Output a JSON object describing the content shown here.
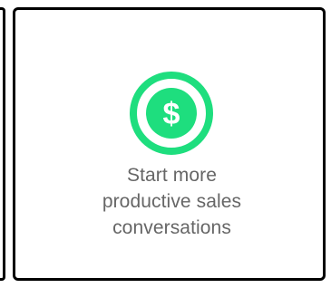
{
  "feature_card": {
    "icon": "dollar-circle-icon",
    "lines": [
      "Start more",
      "productive sales",
      "conversations"
    ]
  },
  "colors": {
    "accent": "#1ede7e",
    "text": "#666666",
    "border": "#000000",
    "background": "#ffffff"
  }
}
